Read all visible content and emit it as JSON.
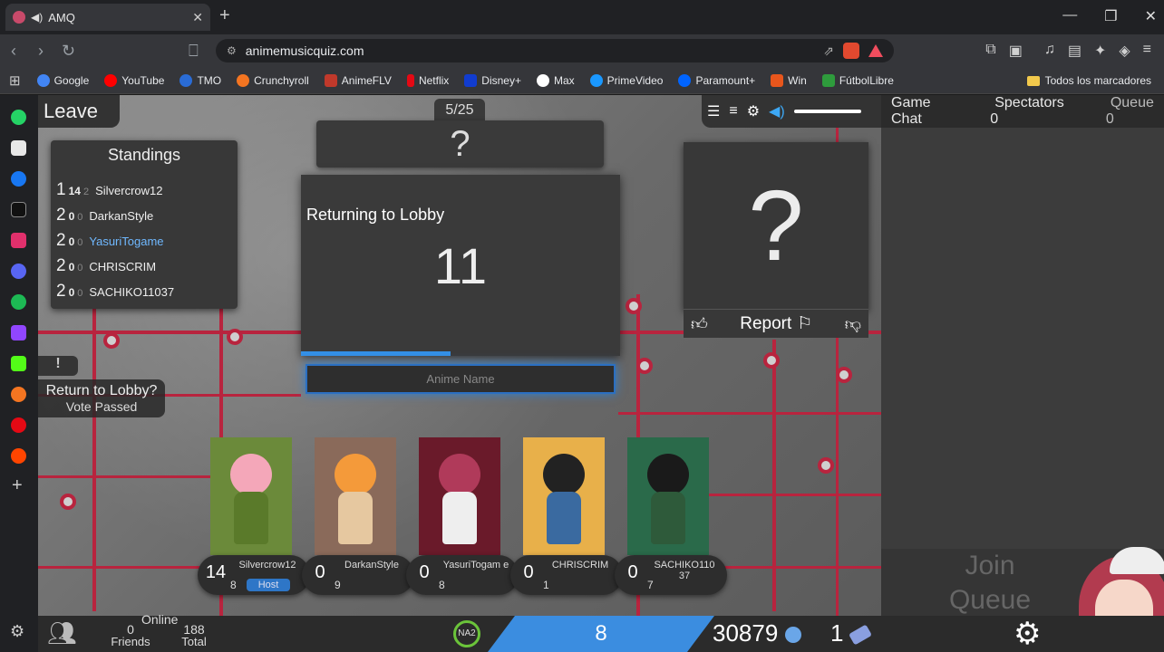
{
  "browser": {
    "tab_title": "AMQ",
    "url": "animemusicquiz.com",
    "bookmarks": [
      {
        "label": "Google",
        "color": "#4285f4"
      },
      {
        "label": "YouTube",
        "color": "#ff0000"
      },
      {
        "label": "TMO",
        "color": "#2a6cd6"
      },
      {
        "label": "Crunchyroll",
        "color": "#f47521"
      },
      {
        "label": "AnimeFLV",
        "color": "#c0392b"
      },
      {
        "label": "Netflix",
        "color": "#e50914"
      },
      {
        "label": "Disney+",
        "color": "#113ccf"
      },
      {
        "label": "Max",
        "color": "#ffffff"
      },
      {
        "label": "PrimeVideo",
        "color": "#1a98ff"
      },
      {
        "label": "Paramount+",
        "color": "#0064ff"
      },
      {
        "label": "Win",
        "color": "#e8561c"
      },
      {
        "label": "FútbolLibre",
        "color": "#2e9b3c"
      }
    ],
    "all_bookmarks": "Todos los marcadores"
  },
  "sidebar_apps": [
    {
      "name": "whatsapp-icon",
      "color": "#25d366"
    },
    {
      "name": "x-icon",
      "color": "#e8e8e8"
    },
    {
      "name": "facebook-icon",
      "color": "#1877f2"
    },
    {
      "name": "tiktok-icon",
      "color": "#111111"
    },
    {
      "name": "instagram-icon",
      "color": "#e1306c"
    },
    {
      "name": "discord-icon",
      "color": "#5865f2"
    },
    {
      "name": "spotify-icon",
      "color": "#1db954"
    },
    {
      "name": "twitch-icon",
      "color": "#9146ff"
    },
    {
      "name": "kick-icon",
      "color": "#53fc18"
    },
    {
      "name": "crunchyroll-icon",
      "color": "#f47521"
    },
    {
      "name": "record-icon",
      "color": "#e50914"
    },
    {
      "name": "reddit-icon",
      "color": "#ff4500"
    }
  ],
  "game": {
    "leave": "Leave",
    "song_counter": "5/25",
    "song_info": "?",
    "standings_title": "Standings",
    "standings": [
      {
        "rank": "1",
        "score": "14",
        "correct": "2",
        "name": "Silvercrow12",
        "self": false
      },
      {
        "rank": "2",
        "score": "0",
        "correct": "0",
        "name": "DarkanStyle",
        "self": false
      },
      {
        "rank": "2",
        "score": "0",
        "correct": "0",
        "name": "YasuriTogame",
        "self": true
      },
      {
        "rank": "2",
        "score": "0",
        "correct": "0",
        "name": "CHRISCRIM",
        "self": false
      },
      {
        "rank": "2",
        "score": "0",
        "correct": "0",
        "name": "SACHIKO11037",
        "self": false
      }
    ],
    "countdown_label": "Returning to Lobby",
    "countdown_value": "11",
    "countdown_progress": 0.47,
    "answer_placeholder": "Anime Name",
    "video_placeholder": "?",
    "report": "Report",
    "vote_flag": "!",
    "vote_question": "Return to Lobby?",
    "vote_status": "Vote Passed",
    "players": [
      {
        "points": "14",
        "name": "Silvercrow12",
        "level": "8",
        "host": "Host",
        "bg": "#6b8a3a",
        "hair": "#f4a7b9",
        "body": "#5a7a2a"
      },
      {
        "points": "0",
        "name": "DarkanStyle",
        "level": "9",
        "host": "",
        "bg": "#8a6a5a",
        "hair": "#f49a3a",
        "body": "#e6c8a0"
      },
      {
        "points": "0",
        "name": "YasuriTogam e",
        "level": "8",
        "host": "",
        "bg": "#6a1a2a",
        "hair": "#b03a5a",
        "body": "#eeeeee"
      },
      {
        "points": "0",
        "name": "CHRISCRIM",
        "level": "1",
        "host": "",
        "bg": "#e8b04a",
        "hair": "#222222",
        "body": "#3a6aa0"
      },
      {
        "points": "0",
        "name": "SACHIKO110 37",
        "level": "7",
        "host": "",
        "bg": "#2a6a4a",
        "hair": "#1a1a1a",
        "body": "#2e5a3a"
      }
    ]
  },
  "chat": {
    "game_chat": "Game Chat",
    "spectators_label": "Spectators",
    "spectators": "0",
    "queue_label": "Queue",
    "queue": "0",
    "join_queue": "Join Queue"
  },
  "footer": {
    "friends": "0",
    "friends_label": "Friends",
    "online_label": "Online",
    "total": "188",
    "total_label": "Total",
    "region": "NA2",
    "level": "8",
    "notes": "30879",
    "tickets": "1"
  }
}
